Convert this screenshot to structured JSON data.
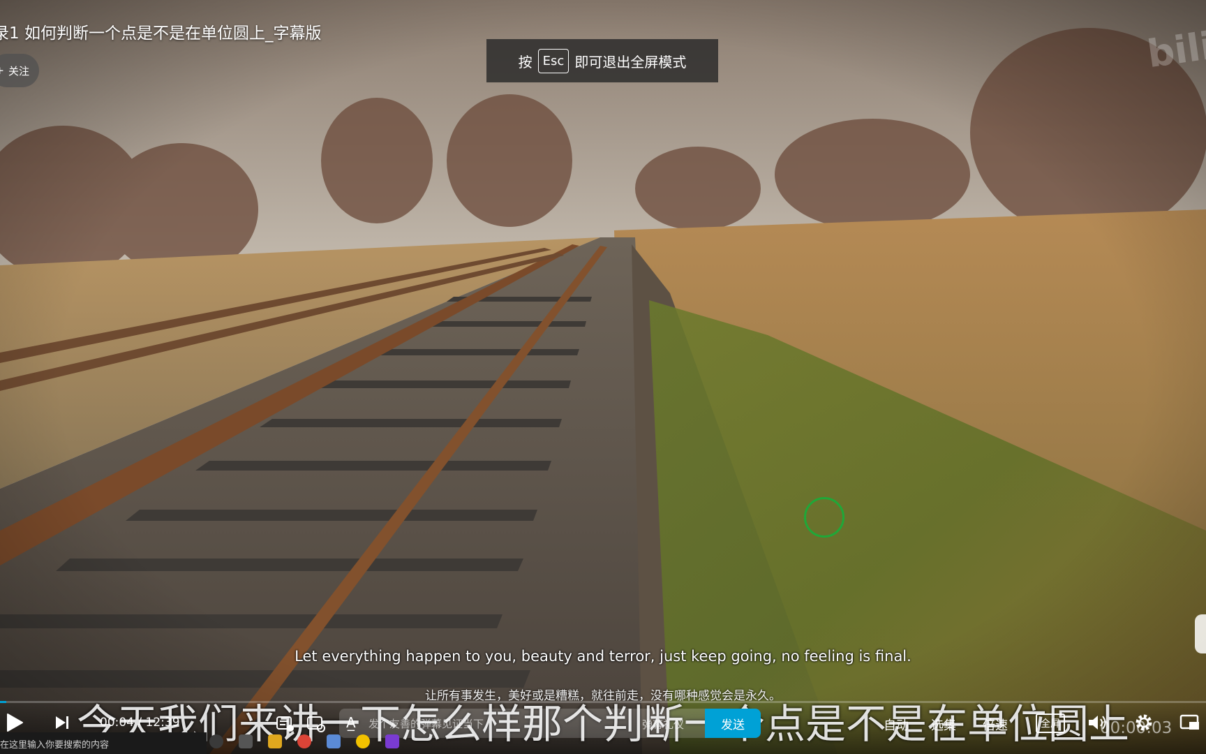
{
  "video": {
    "title": "录1 如何判断一个点是不是在单位圆上_字幕版",
    "follow_label": "关注",
    "follow_plus": "+",
    "esc_toast": {
      "prefix": "按",
      "key": "Esc",
      "suffix": "即可退出全屏模式"
    },
    "watermark": "bili"
  },
  "subtitles": {
    "english": "Let everything happen to you, beauty and terror, just keep going, no feeling is final.",
    "chinese": "让所有事发生，美好或是糟糕，就往前走，没有哪种感觉会是永久。",
    "caption": "今天我们来讲一下怎么样那个判断一个点是不是在单位圆上"
  },
  "controls": {
    "current_time": "00:04",
    "separator": "/",
    "duration": "12:39",
    "progress_fraction": 0.005,
    "danmaku_placeholder": "发个友善的弹幕见证当下",
    "danmaku_etiquette": "弹幕礼仪",
    "send_label": "发送",
    "quality_label": "自动",
    "episodes_label": "选集",
    "speed_label": "倍速",
    "fullscreen_label": "全屏",
    "remaining_time": "00:00:03",
    "accent_color": "#00a1d6"
  },
  "taskbar": {
    "search_placeholder": "在这里输入你要搜索的内容"
  }
}
